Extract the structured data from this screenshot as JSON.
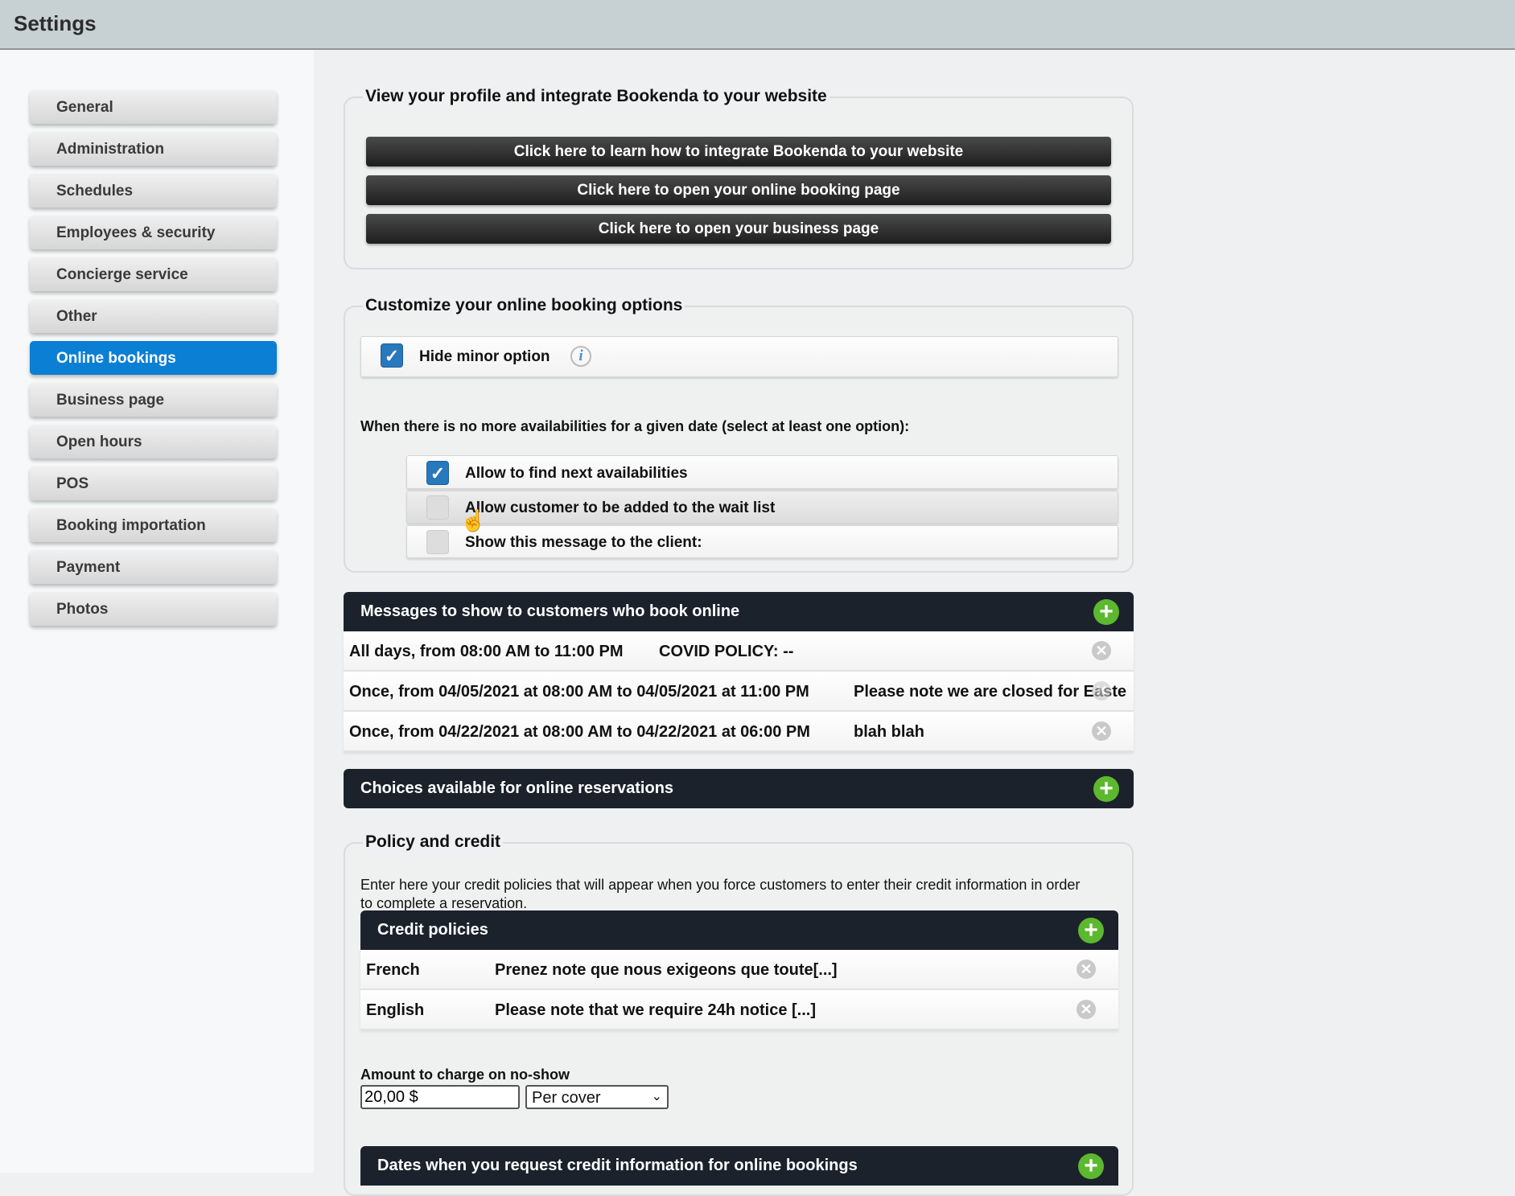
{
  "header": {
    "title": "Settings"
  },
  "sidebar": {
    "items": [
      {
        "label": "General"
      },
      {
        "label": "Administration"
      },
      {
        "label": "Schedules"
      },
      {
        "label": "Employees & security"
      },
      {
        "label": "Concierge service"
      },
      {
        "label": "Other"
      },
      {
        "label": "Online bookings",
        "active": true
      },
      {
        "label": "Business page"
      },
      {
        "label": "Open hours"
      },
      {
        "label": "POS"
      },
      {
        "label": "Booking importation"
      },
      {
        "label": "Payment"
      },
      {
        "label": "Photos"
      }
    ]
  },
  "profile": {
    "legend": "View your profile and integrate Bookenda to your website",
    "buttons": [
      "Click here to learn how to integrate Bookenda to your website",
      "Click here to open your online booking page",
      "Click here to open your business page"
    ]
  },
  "options": {
    "legend": "Customize your online booking options",
    "hide_minor": {
      "label": "Hide minor option",
      "checked": true
    },
    "question": "When there is no more availabilities for a given date (select at least one option):",
    "choices": [
      {
        "label": "Allow to find next availabilities",
        "checked": true
      },
      {
        "label": "Allow customer to be added to the wait list",
        "checked": false
      },
      {
        "label": "Show this message to the client:",
        "checked": false
      }
    ]
  },
  "messages": {
    "title": "Messages to show to customers who book online",
    "rows": [
      {
        "when": "All days, from 08:00 AM to 11:00 PM",
        "text": "COVID POLICY: --"
      },
      {
        "when": "Once, from 04/05/2021 at 08:00 AM to 04/05/2021 at 11:00 PM",
        "text": "Please note we are closed for Easte"
      },
      {
        "when": "Once, from 04/22/2021 at 08:00 AM to 04/22/2021 at 06:00 PM",
        "text": "blah blah"
      }
    ]
  },
  "choices": {
    "title": "Choices available for online reservations"
  },
  "policy": {
    "legend": "Policy and credit",
    "description": "Enter here your credit policies that will appear when you force customers to enter their credit information in order to complete a reservation.",
    "credit_title": "Credit policies",
    "credit_rows": [
      {
        "lang": "French",
        "text": "Prenez note que nous exigeons que toute[...]"
      },
      {
        "lang": "English",
        "text": "Please note that we require 24h notice [...]"
      }
    ],
    "amount_label": "Amount to charge on no-show",
    "amount_value": "20,00 $",
    "per_value": "Per cover",
    "dates_title": "Dates when you request credit information for online bookings"
  },
  "colors": {
    "accent": "#0b7fd3",
    "panel_header": "#1c222b",
    "add": "#5cb82e"
  }
}
